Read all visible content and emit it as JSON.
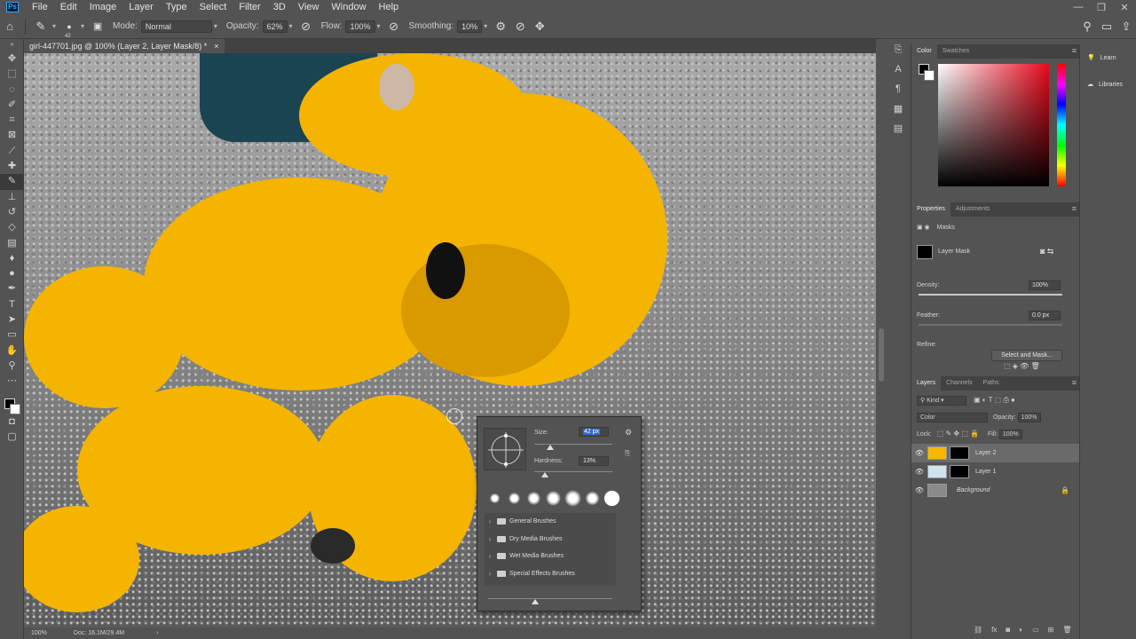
{
  "app": {
    "logo": "Ps"
  },
  "menubar": {
    "items": [
      "File",
      "Edit",
      "Image",
      "Layer",
      "Type",
      "Select",
      "Filter",
      "3D",
      "View",
      "Window",
      "Help"
    ],
    "window_controls": [
      "—",
      "❐",
      "✕"
    ]
  },
  "options_bar": {
    "brush_size": "42",
    "mode_label": "Mode:",
    "mode_value": "Normal",
    "opacity_label": "Opacity:",
    "opacity_value": "62%",
    "flow_label": "Flow:",
    "flow_value": "100%",
    "smoothing_label": "Smoothing:",
    "smoothing_value": "10%"
  },
  "document": {
    "tab_title": "girl-447701.jpg @ 100% (Layer 2, Layer Mask/8) *",
    "tab_close": "×"
  },
  "status_bar": {
    "zoom": "100%",
    "doc_info": "Doc: 16.1M/29.4M",
    "arrow": "›"
  },
  "color_panel": {
    "tabs": [
      "Color",
      "Swatches"
    ]
  },
  "properties_panel": {
    "tabs": [
      "Properties",
      "Adjustments"
    ],
    "section_label": "Masks",
    "layer_mask_label": "Layer Mask",
    "density_label": "Density:",
    "density_value": "100%",
    "density_level": 1.0,
    "feather_label": "Feather:",
    "feather_value": "0.0 px",
    "feather_level": 0.0,
    "refine_label": "Refine:",
    "select_mask_button": "Select and Mask..."
  },
  "layers_panel": {
    "tabs": [
      "Layers",
      "Channels",
      "Paths"
    ],
    "filter_kind": "Kind",
    "blend_mode": "Color",
    "opacity_label": "Opacity:",
    "opacity_value": "100%",
    "lock_label": "Lock:",
    "fill_label": "Fill:",
    "fill_value": "100%",
    "layers": [
      {
        "name": "Layer 2",
        "selected": true,
        "thumb_color": "#f6b800"
      },
      {
        "name": "Layer 1",
        "selected": false,
        "thumb_color": "#cfe3ee"
      },
      {
        "name": "Background",
        "selected": false,
        "thumb_color": "#8a8a8a"
      }
    ]
  },
  "right_nav": {
    "items": [
      "Learn",
      "Libraries"
    ]
  },
  "brush_popup": {
    "size_label": "Size:",
    "size_value": "42 px",
    "hardness_label": "Hardness:",
    "hardness_value": "13%",
    "folders": [
      "General Brushes",
      "Dry Media Brushes",
      "Wet Media Brushes",
      "Special Effects Brushes"
    ]
  },
  "colors": {
    "ui_bg": "#535353",
    "overlay_yellow": "#f4b400",
    "hue_accent": "#e8091c"
  }
}
